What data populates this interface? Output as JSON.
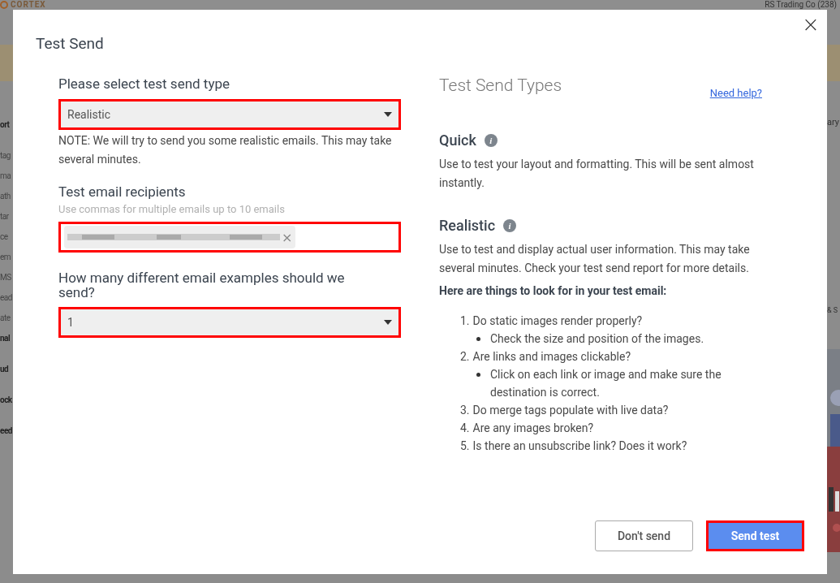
{
  "background": {
    "logo": "CORTEX",
    "account": "RS Trading Co (238)",
    "sidebar_fragments": [
      {
        "text": "ort",
        "kind": "section"
      },
      {
        "text": "tag",
        "kind": "item"
      },
      {
        "text": "ma",
        "kind": "item"
      },
      {
        "text": "ath",
        "kind": "item"
      },
      {
        "text": "tar",
        "kind": "item"
      },
      {
        "text": "ce",
        "kind": "item"
      },
      {
        "text": "em",
        "kind": "item"
      },
      {
        "text": "MS",
        "kind": "item"
      },
      {
        "text": "ead",
        "kind": "item"
      },
      {
        "text": "ate",
        "kind": "item"
      },
      {
        "text": "nal",
        "kind": "section"
      },
      {
        "text": "ud",
        "kind": "section"
      },
      {
        "text": "ock",
        "kind": "section"
      },
      {
        "text": "eed",
        "kind": "section"
      }
    ],
    "right_fragments": [
      "ary",
      "& S"
    ]
  },
  "dialog": {
    "title": "Test Send",
    "close": "×",
    "form": {
      "type_label": "Please select test send type",
      "type_value": "Realistic",
      "type_highlighted": true,
      "note": "NOTE: We will try to send you some realistic emails. This may take several minutes.",
      "recipients_label": "Test email recipients",
      "recipients_hint": "Use commas for multiple emails up to 10 emails",
      "recipients_highlighted": true,
      "chip_remove": "×",
      "count_label": "How many different email examples should we send?",
      "count_value": "1",
      "count_highlighted": true
    },
    "info": {
      "title": "Test Send Types",
      "help_link": "Need help?",
      "types": [
        {
          "name": "Quick",
          "info": "i",
          "description": "Use to test your layout and formatting. This will be sent almost instantly."
        },
        {
          "name": "Realistic",
          "info": "i",
          "description": "Use to test and display actual user information. This may take several minutes. Check your test send report for more details."
        }
      ],
      "checklist_title": "Here are things to look for in your test email:",
      "checklist": [
        {
          "number": "1.",
          "text": "Do static images render properly?",
          "children": [
            {
              "text": "Check the size and position of the images."
            }
          ]
        },
        {
          "number": "2.",
          "text": "Are links and images clickable?",
          "children": [
            {
              "text": "Click on each link or image and make sure the destination is correct."
            }
          ]
        },
        {
          "number": "3.",
          "text": "Do merge tags populate with live data?"
        },
        {
          "number": "4.",
          "text": "Are any images broken?"
        },
        {
          "number": "5.",
          "text": "Is there an unsubscribe link? Does it work?"
        }
      ]
    },
    "buttons": [
      {
        "label": "Don't send",
        "kind": "secondary",
        "highlighted": false
      },
      {
        "label": "Send test",
        "kind": "primary",
        "highlighted": true
      }
    ]
  }
}
